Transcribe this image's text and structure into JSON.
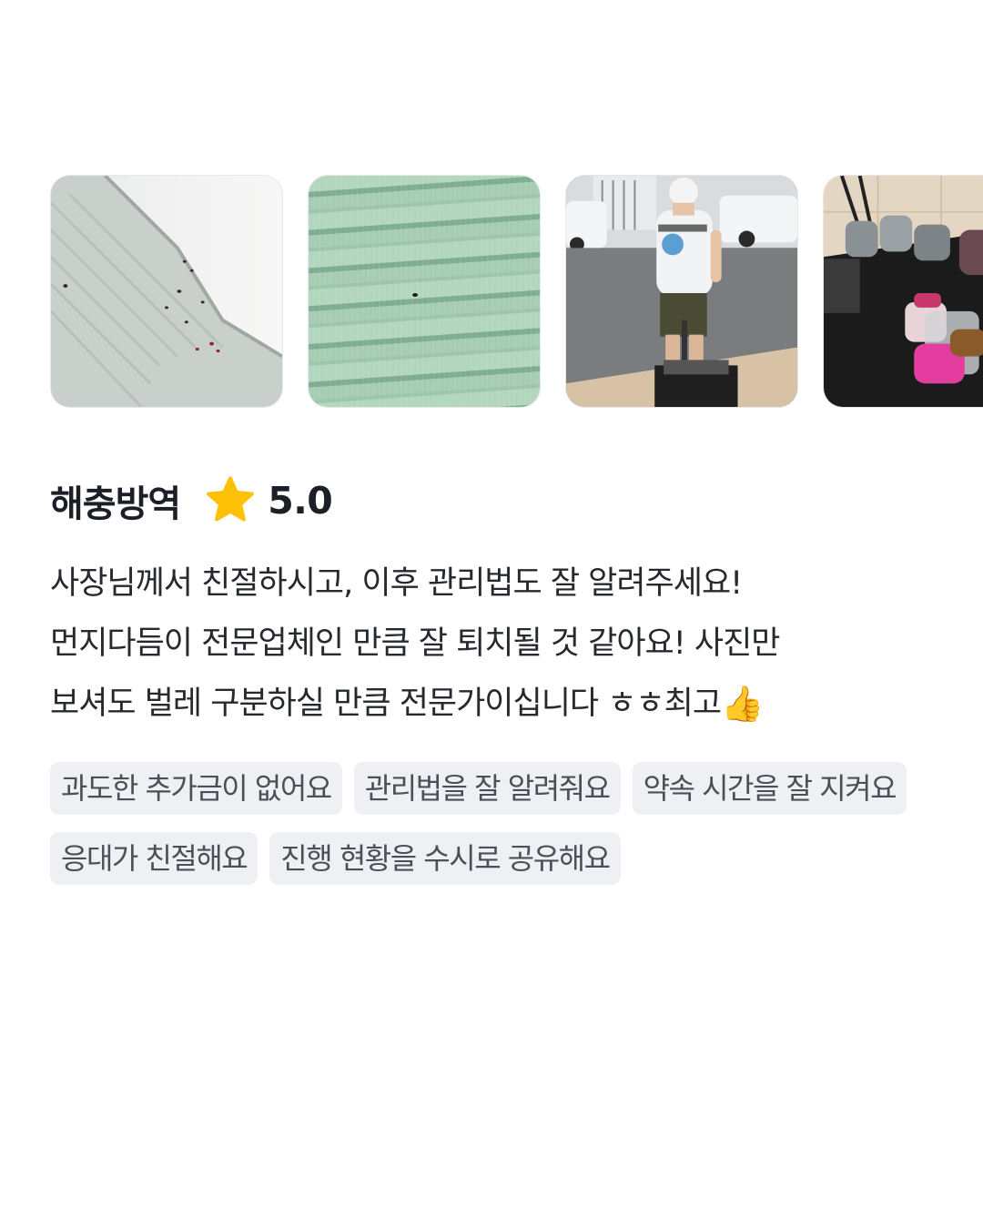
{
  "photos": [
    {
      "icon": "bug-on-ceiling-corner-photo"
    },
    {
      "icon": "bug-on-green-fabric-photo"
    },
    {
      "icon": "technician-with-cart-photo"
    },
    {
      "icon": "equipment-cart-photo"
    }
  ],
  "review": {
    "category": "해충방역",
    "star_icon": "star-icon",
    "star_color": "#FFC107",
    "rating": "5.0",
    "text_lines": [
      "사장님께서 친절하시고, 이후 관리법도 잘 알려주세요!",
      "먼지다듬이 전문업체인 만큼 잘 퇴치될 것 같아요! 사진만",
      "보셔도 벌레 구분하실 만큼 전문가이십니다 ㅎㅎ최고"
    ],
    "thumbs_emoji": "👍",
    "tags": [
      "과도한 추가금이 없어요",
      "관리법을 잘 알려줘요",
      "약속 시간을 잘 지켜요",
      "응대가 친절해요",
      "진행 현황을 수시로 공유해요"
    ]
  }
}
